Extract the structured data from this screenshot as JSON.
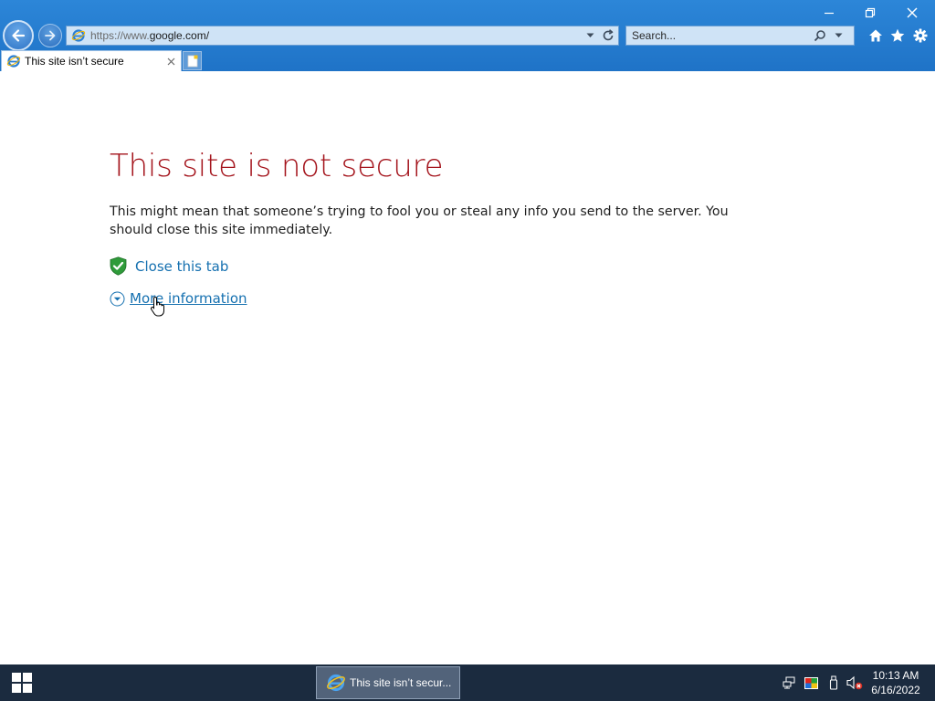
{
  "browser": {
    "address": {
      "protocol": "https://www.",
      "domain": "google.com/"
    },
    "search": {
      "placeholder": "Search..."
    },
    "tab": {
      "title": "This site isn’t secure"
    }
  },
  "page": {
    "title": "This site is not secure",
    "description": "This might mean that someone’s trying to fool you or steal any info you send to the server. You should close this site immediately.",
    "close_tab": "Close this tab",
    "more_info": "More information"
  },
  "taskbar": {
    "active_window": "This site isn’t secur...",
    "clock": {
      "time": "10:13 AM",
      "date": "6/16/2022"
    }
  },
  "colors": {
    "title_red": "#a4141c",
    "link_blue": "#1570b0",
    "chrome_blue": "#1f73c7",
    "taskbar": "#1b2b3f"
  },
  "icons": [
    "back-arrow-icon",
    "forward-arrow-icon",
    "ie-icon",
    "dropdown-icon",
    "refresh-icon",
    "search-icon",
    "home-icon",
    "favorites-star-icon",
    "settings-gear-icon",
    "minimize-icon",
    "restore-icon",
    "close-icon",
    "tab-close-icon",
    "new-tab-icon",
    "shield-check-icon",
    "expand-chevron-icon",
    "hand-cursor-icon",
    "windows-start-icon",
    "network-icon",
    "color-icon",
    "usb-icon",
    "volume-muted-icon"
  ]
}
